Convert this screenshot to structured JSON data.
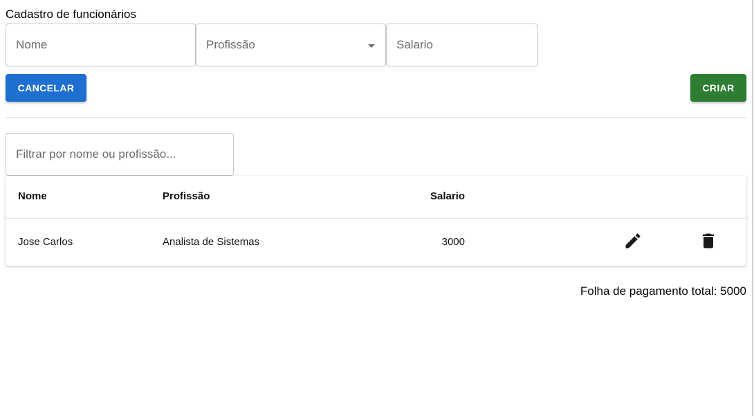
{
  "page": {
    "title": "Cadastro de funcionários"
  },
  "form": {
    "nome_placeholder": "Nome",
    "profissao_placeholder": "Profissão",
    "salario_placeholder": "Salario",
    "cancel_label": "CANCELAR",
    "create_label": "CRIAR"
  },
  "filter": {
    "placeholder": "Filtrar por nome ou profissão..."
  },
  "table": {
    "headers": {
      "nome": "Nome",
      "profissao": "Profissão",
      "salario": "Salario"
    },
    "rows": [
      {
        "nome": "Jose Carlos",
        "profissao": "Analista de Sistemas",
        "salario": "3000",
        "actions": [
          "pencil-icon",
          "trash-icon"
        ]
      }
    ]
  },
  "footer": {
    "total_label": "Folha de pagamento total: 5000"
  },
  "colors": {
    "cancel_button": "#1e6fd0",
    "create_button": "#2e7d32"
  }
}
